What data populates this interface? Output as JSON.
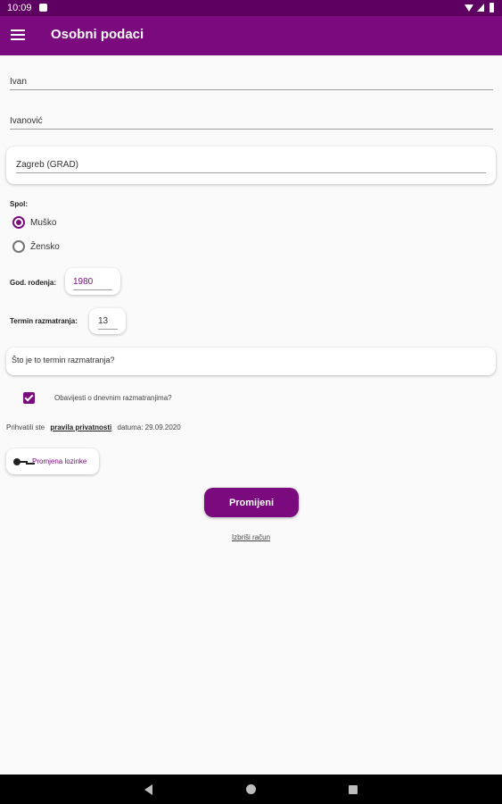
{
  "status_bar": {
    "time": "10:09"
  },
  "app_bar": {
    "title": "Osobni podaci"
  },
  "form": {
    "first_name": "Ivan",
    "last_name": "Ivanović",
    "city": "Zagreb (GRAD)",
    "gender_label": "Spol:",
    "gender_options": [
      "Muško",
      "Žensko"
    ],
    "gender_selected": "Muško",
    "birth_year_label": "God. rođenja:",
    "birth_year": "1980",
    "term_label": "Termin razmatranja:",
    "term_value": "13",
    "term_question": "Što je to termin razmatranja?",
    "notify_label": "Obavijesti o dnevnim razmatranjima?",
    "notify_checked": true
  },
  "privacy": {
    "prefix": "Prihvatili ste",
    "link": "pravila privatnosti",
    "suffix": "datuma: 29.09.2020"
  },
  "buttons": {
    "change_password": "Promjena lozinke",
    "submit": "Promijeni",
    "delete_account": "Izbriši račun"
  },
  "icons": {
    "menu": "hamburger-menu-icon",
    "key": "key-icon",
    "back": "back-triangle-icon",
    "home": "home-circle-icon",
    "recents": "recents-square-icon"
  },
  "colors": {
    "primary": "#7a0a7e",
    "status_bar": "#5e0062"
  }
}
